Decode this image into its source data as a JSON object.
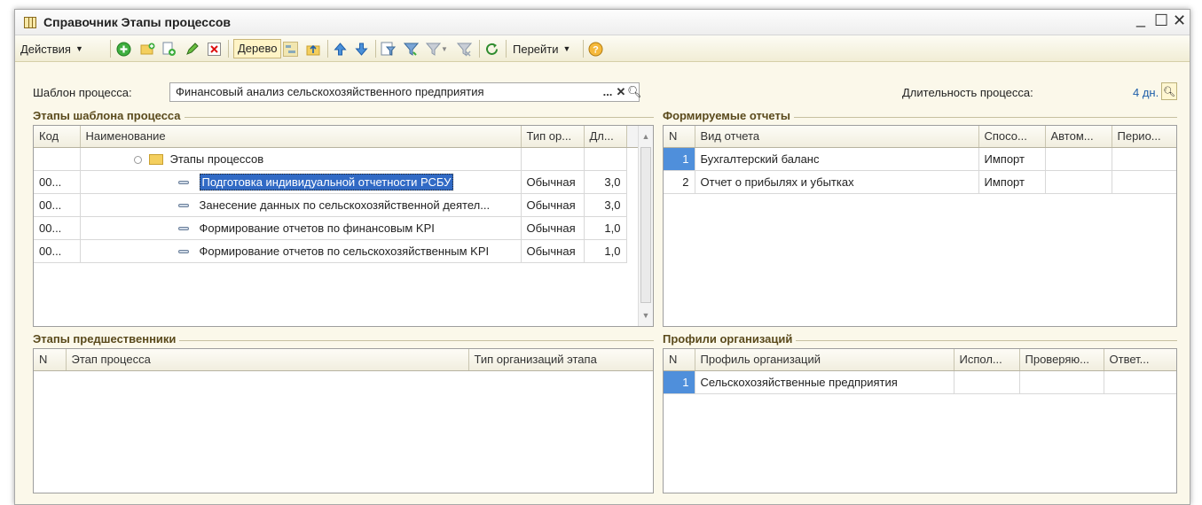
{
  "window": {
    "title": "Справочник Этапы процессов"
  },
  "toolbar": {
    "actions_label": "Действия",
    "tree_label": "Дерево",
    "goto_label": "Перейти"
  },
  "form": {
    "template_label": "Шаблон процесса:",
    "template_value": "Финансовый анализ сельскохозяйственного предприятия",
    "duration_label": "Длительность процесса:",
    "duration_value": "4 дн."
  },
  "stages": {
    "title": "Этапы шаблона процесса",
    "columns": [
      "Код",
      "Наименование",
      "Тип ор...",
      "Дл..."
    ],
    "group_row": "Этапы процессов",
    "rows": [
      {
        "code": "00...",
        "name": "Подготовка индивидуальной отчетности РСБУ",
        "type": "Обычная",
        "dur": "3,0"
      },
      {
        "code": "00...",
        "name": "Занесение данных по сельскохозяйственной деятел...",
        "type": "Обычная",
        "dur": "3,0"
      },
      {
        "code": "00...",
        "name": "Формирование отчетов по финансовым KPI",
        "type": "Обычная",
        "dur": "1,0"
      },
      {
        "code": "00...",
        "name": "Формирование отчетов по сельскохозяйственным KPI",
        "type": "Обычная",
        "dur": "1,0"
      }
    ]
  },
  "reports": {
    "title": "Формируемые отчеты",
    "columns": [
      "N",
      "Вид отчета",
      "Спосо...",
      "Автом...",
      "Перио..."
    ],
    "rows": [
      {
        "n": "1",
        "name": "Бухгалтерский баланс",
        "method": "Импорт"
      },
      {
        "n": "2",
        "name": "Отчет о прибылях и убытках",
        "method": "Импорт"
      }
    ]
  },
  "predecessors": {
    "title": "Этапы предшественники",
    "columns": [
      "N",
      "Этап процесса",
      "Тип организаций этапа"
    ]
  },
  "profiles": {
    "title": "Профили организаций",
    "columns": [
      "N",
      "Профиль организаций",
      "Испол...",
      "Проверяю...",
      "Ответ..."
    ],
    "rows": [
      {
        "n": "1",
        "name": "Сельскохозяйственные предприятия"
      }
    ]
  }
}
